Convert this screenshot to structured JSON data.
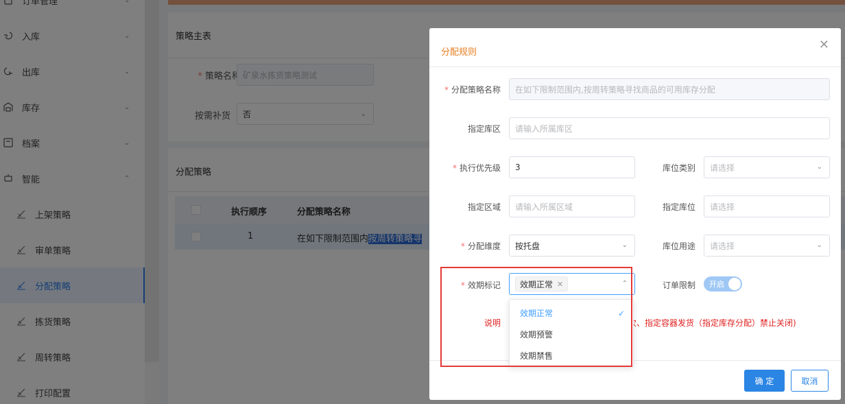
{
  "sidebar": {
    "items": [
      {
        "label": "订单管理",
        "icon": "order-icon"
      },
      {
        "label": "入库",
        "icon": "inbound-icon"
      },
      {
        "label": "出库",
        "icon": "outbound-icon"
      },
      {
        "label": "库存",
        "icon": "warehouse-icon"
      },
      {
        "label": "档案",
        "icon": "archive-icon"
      },
      {
        "label": "智能",
        "icon": "smart-icon"
      }
    ],
    "subitems": [
      {
        "label": "上架策略",
        "icon": "strategy-icon"
      },
      {
        "label": "审单策略",
        "icon": "strategy-icon"
      },
      {
        "label": "分配策略",
        "icon": "strategy-icon",
        "active": true
      },
      {
        "label": "拣货策略",
        "icon": "strategy-icon"
      },
      {
        "label": "周转策略",
        "icon": "strategy-icon"
      },
      {
        "label": "打印配置",
        "icon": "strategy-icon"
      }
    ]
  },
  "main": {
    "master_title": "策略主表",
    "policy_name_label": "策略名称",
    "policy_name_value": "矿泉水拣货策略测试",
    "replenish_label": "按需补货",
    "replenish_value": "否",
    "alloc_title": "分配策略",
    "table": {
      "headers": [
        "执行顺序",
        "分配策略名称"
      ],
      "rows": [
        {
          "order": "1",
          "name_prefix": "在如下限制范围内",
          "name_highlight": "按周转策略寻"
        }
      ]
    }
  },
  "dialog": {
    "title": "分配规则",
    "fields": {
      "strategy_name_label": "分配策略名称",
      "strategy_name_value": "在如下限制范围内,按周转策略寻找商品的可用库存分配",
      "zone_label": "指定库区",
      "zone_placeholder": "请输入所属库区",
      "priority_label": "执行优先级",
      "priority_value": "3",
      "loc_type_label": "库位类别",
      "loc_type_placeholder": "请选择",
      "area_label": "指定区域",
      "area_placeholder": "请输入所属区域",
      "location_label": "指定库位",
      "location_placeholder": "请选择",
      "dimension_label": "分配维度",
      "dimension_value": "按托盘",
      "loc_usage_label": "库位用途",
      "loc_usage_placeholder": "请选择",
      "expiry_label": "效期标记",
      "expiry_tag": "效期正常",
      "order_limit_label": "订单限制",
      "order_limit_toggle": "开启"
    },
    "note_prefix": "说明",
    "note_suffix": "次、指定容器发货（指定库存分配）禁止关闭)",
    "dropdown_options": [
      "效期正常",
      "效期预警",
      "效期禁售"
    ],
    "dropdown_selected": "效期正常",
    "confirm_label": "确 定",
    "cancel_label": "取消"
  }
}
